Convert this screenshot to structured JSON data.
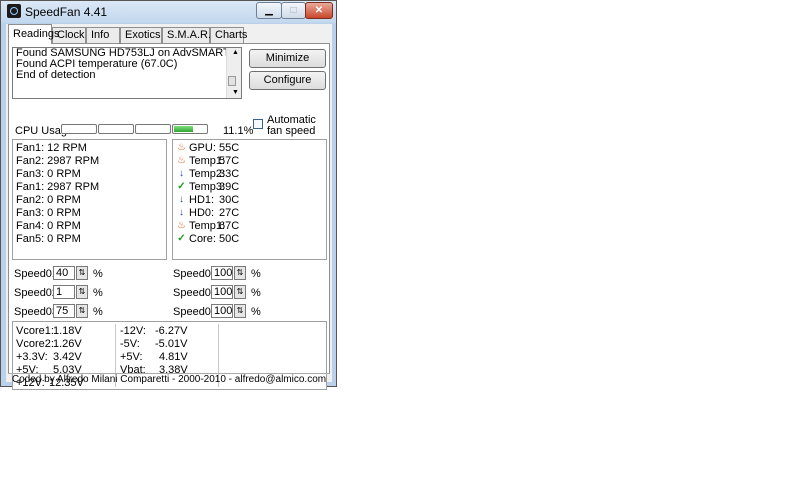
{
  "window": {
    "title": "SpeedFan 4.41"
  },
  "tabs": [
    "Readings",
    "Clock",
    "Info",
    "Exotics",
    "S.M.A.R.T.",
    "Charts"
  ],
  "log": [
    "Found SAMSUNG HD753LJ on AdvSMART",
    "Found ACPI temperature (67.0C)",
    "End of detection"
  ],
  "buttons": {
    "minimize": "Minimize",
    "configure": "Configure"
  },
  "auto_fan": {
    "label": "Automatic fan speed",
    "checked": false
  },
  "cpu": {
    "label": "CPU Usage",
    "value": "11.1%",
    "bars": [
      0.0,
      0.0,
      0.0,
      0.6
    ]
  },
  "fans": [
    "Fan1: 12 RPM",
    "Fan2: 2987 RPM",
    "Fan3: 0 RPM",
    "Fan1: 2987 RPM",
    "Fan2: 0 RPM",
    "Fan3: 0 RPM",
    "Fan4: 0 RPM",
    "Fan5: 0 RPM"
  ],
  "temps": [
    {
      "label": "GPU:",
      "value": "55C",
      "icon": "flame-icon"
    },
    {
      "label": "Temp1:",
      "value": "57C",
      "icon": "flame-icon"
    },
    {
      "label": "Temp2:",
      "value": "33C",
      "icon": "arrow-down-icon"
    },
    {
      "label": "Temp3:",
      "value": "39C",
      "icon": "check-icon"
    },
    {
      "label": "HD1:",
      "value": "30C",
      "icon": "arrow-down-icon"
    },
    {
      "label": "HD0:",
      "value": "27C",
      "icon": "arrow-down-icon"
    },
    {
      "label": "Temp1:",
      "value": "67C",
      "icon": "flame-icon"
    },
    {
      "label": "Core:",
      "value": "50C",
      "icon": "check-icon"
    }
  ],
  "speeds": [
    {
      "label": "Speed01:",
      "value": "40"
    },
    {
      "label": "Speed02:",
      "value": "1"
    },
    {
      "label": "Speed03:",
      "value": "75"
    },
    {
      "label": "Speed04:",
      "value": "100"
    },
    {
      "label": "Speed05:",
      "value": "100"
    },
    {
      "label": "Speed06:",
      "value": "100"
    }
  ],
  "percent_sign": "%",
  "voltages_left": [
    {
      "label": "Vcore1:",
      "value": "1.18V"
    },
    {
      "label": "Vcore2:",
      "value": "1.26V"
    },
    {
      "label": "+3.3V:",
      "value": "3.42V"
    },
    {
      "label": "+5V:",
      "value": "5.03V"
    },
    {
      "label": "+12V:",
      "value": "12.35V"
    }
  ],
  "voltages_right": [
    {
      "label": "-12V:",
      "value": "-6.27V"
    },
    {
      "label": "-5V:",
      "value": "-5.01V"
    },
    {
      "label": "+5V:",
      "value": "4.81V"
    },
    {
      "label": "Vbat:",
      "value": "3.38V"
    }
  ],
  "footer": "Coded by Alfredo Milani Comparetti - 2000-2010 - alfredo@almico.com",
  "icons": {
    "app": "speedfan-icon",
    "minimize": "window-minimize-icon",
    "maximize": "window-maximize-icon",
    "close": "window-close-icon"
  }
}
